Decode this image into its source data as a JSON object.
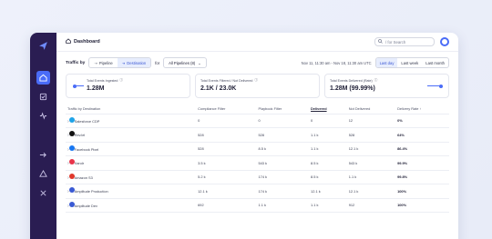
{
  "header": {
    "title": "Dashboard",
    "search_placeholder": "/ for Search"
  },
  "filters": {
    "label": "Traffic by",
    "tabs": [
      "Pipeline",
      "Destination"
    ],
    "for_label": "for",
    "pipeline_select": "All Pipelines (8)",
    "date_range": "Nov 11, 11:30 am - Nov 18, 11:30 am UTC",
    "time_tabs": [
      "Last day",
      "Last week",
      "Last month"
    ]
  },
  "cards": [
    {
      "title": "Total Events Ingested",
      "value": "1.28M"
    },
    {
      "title": "Total Events Filtered / Not Delivered",
      "value": "2.1K / 23.0K"
    },
    {
      "title": "Total Events Delivered (Rate)",
      "value": "1.28M (99.99%)"
    }
  ],
  "table": {
    "headers": [
      "Traffic by Destination",
      "Compliance Filter",
      "Playbook Filter",
      "Delivered",
      "Not Delivered",
      "Delivery Rate"
    ],
    "rows": [
      {
        "name": "Salesforce CDP",
        "icon": "salesforce-icon",
        "color": "#1fa3e8",
        "cf": "0",
        "pf": "0",
        "del": "0",
        "nd": "12",
        "rate": "0%"
      },
      {
        "name": "Rev.lel",
        "icon": "revlel-icon",
        "color": "#111111",
        "cf": "528",
        "pf": "528",
        "del": "1.1 k",
        "nd": "528",
        "rate": "64%"
      },
      {
        "name": "Facebook Pixel",
        "icon": "facebook-icon",
        "color": "#1877f2",
        "cf": "528",
        "pf": "8.5 k",
        "del": "1.1 k",
        "nd": "12.1 k",
        "rate": "86.4%"
      },
      {
        "name": "Xandr",
        "icon": "xandr-icon",
        "color": "#e8344a",
        "cf": "3.5 k",
        "pf": "543 k",
        "del": "8.5 k",
        "nd": "543 k",
        "rate": "99.9%"
      },
      {
        "name": "Amazon S3",
        "icon": "amazon-s3-icon",
        "color": "#e0382b",
        "cf": "5.2 k",
        "pf": "174 k",
        "del": "8.5 k",
        "nd": "1.1 k",
        "rate": "99.8%"
      },
      {
        "name": "Amplitude Production",
        "icon": "amplitude-icon",
        "color": "#3a5ad4",
        "cf": "12.1 k",
        "pf": "174 k",
        "del": "12.1 k",
        "nd": "12.1 k",
        "rate": "100%"
      },
      {
        "name": "Amplitude Dev",
        "icon": "amplitude-icon",
        "color": "#3a5ad4",
        "cf": "692",
        "pf": "1.1 k",
        "del": "1.1 k",
        "nd": "912",
        "rate": "100%"
      }
    ]
  },
  "colors": {
    "sidebar": "#2a1d52",
    "accent": "#4a6cf7"
  }
}
